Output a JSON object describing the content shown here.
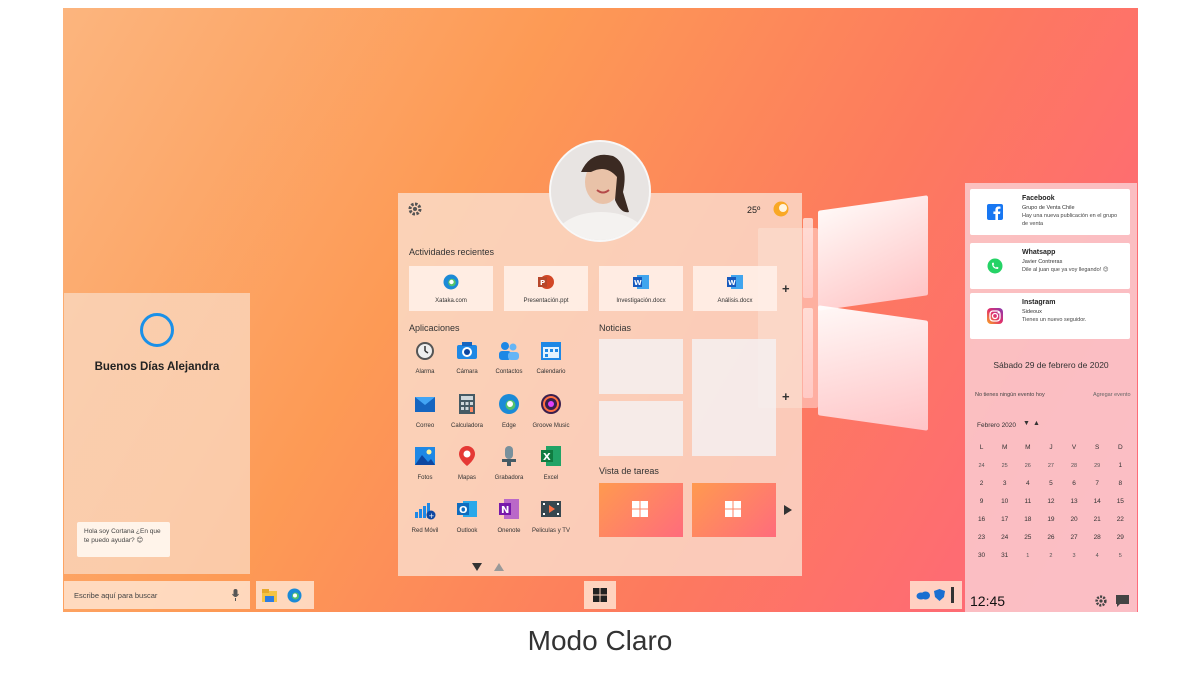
{
  "caption": "Modo Claro",
  "cortana": {
    "greeting": "Buenos Días Alejandra",
    "bubble_text": "Hola soy Cortana ¿En que te puedo ayudar? 😊"
  },
  "taskbar": {
    "search_placeholder": "Escribe aquí para buscar"
  },
  "start": {
    "temperature": "25º",
    "recent_title": "Actividades recientes",
    "recent": [
      {
        "label": "Xataka.com",
        "icon": "edge-icon"
      },
      {
        "label": "Presentación.ppt",
        "icon": "powerpoint-icon"
      },
      {
        "label": "Investigación.docx",
        "icon": "word-icon"
      },
      {
        "label": "Análisis.docx",
        "icon": "word-icon"
      }
    ],
    "apps_title": "Aplicaciones",
    "apps": [
      {
        "label": "Alarma"
      },
      {
        "label": "Cámara"
      },
      {
        "label": "Contactos"
      },
      {
        "label": "Calendario"
      },
      {
        "label": "Correo"
      },
      {
        "label": "Calculadora"
      },
      {
        "label": "Edge"
      },
      {
        "label": "Groove Music"
      },
      {
        "label": "Fotos"
      },
      {
        "label": "Mapas"
      },
      {
        "label": "Grabadora"
      },
      {
        "label": "Excel"
      },
      {
        "label": "Red Móvil"
      },
      {
        "label": "Outlook"
      },
      {
        "label": "Onenote"
      },
      {
        "label": "Peliculas y TV"
      }
    ],
    "news_title": "Noticias",
    "tasks_title": "Vista de tareas"
  },
  "notifications": [
    {
      "title": "Facebook",
      "subtitle": "Grupo de Venta Chile",
      "message": "Hay una nueva publicación en el grupo de venta"
    },
    {
      "title": "Whatsapp",
      "subtitle": "Javier Contreras",
      "message": "Dile al juan que ya voy llegando! 😊"
    },
    {
      "title": "Instagram",
      "subtitle": "Sideoux",
      "message": "Tienes un nuevo seguidor."
    }
  ],
  "calendar": {
    "date_title": "Sábado 29 de febrero de 2020",
    "no_events": "No tienes ningún evento hoy",
    "add_event": "Agregar evento",
    "month_label": "Febrero 2020",
    "weekdays": [
      "L",
      "M",
      "M",
      "J",
      "V",
      "S",
      "D"
    ],
    "rows": [
      [
        "24",
        "25",
        "26",
        "27",
        "28",
        "29",
        "1"
      ],
      [
        "2",
        "3",
        "4",
        "5",
        "6",
        "7",
        "8"
      ],
      [
        "9",
        "10",
        "11",
        "12",
        "13",
        "14",
        "15"
      ],
      [
        "16",
        "17",
        "18",
        "19",
        "20",
        "21",
        "22"
      ],
      [
        "23",
        "24",
        "25",
        "26",
        "27",
        "28",
        "29"
      ],
      [
        "30",
        "31",
        "1",
        "2",
        "3",
        "4",
        "5"
      ]
    ]
  },
  "clock": "12:45",
  "colors": {
    "accent": "#1a90e8",
    "gradient_start": "#fcb57e",
    "gradient_end": "#ff6c7c"
  }
}
